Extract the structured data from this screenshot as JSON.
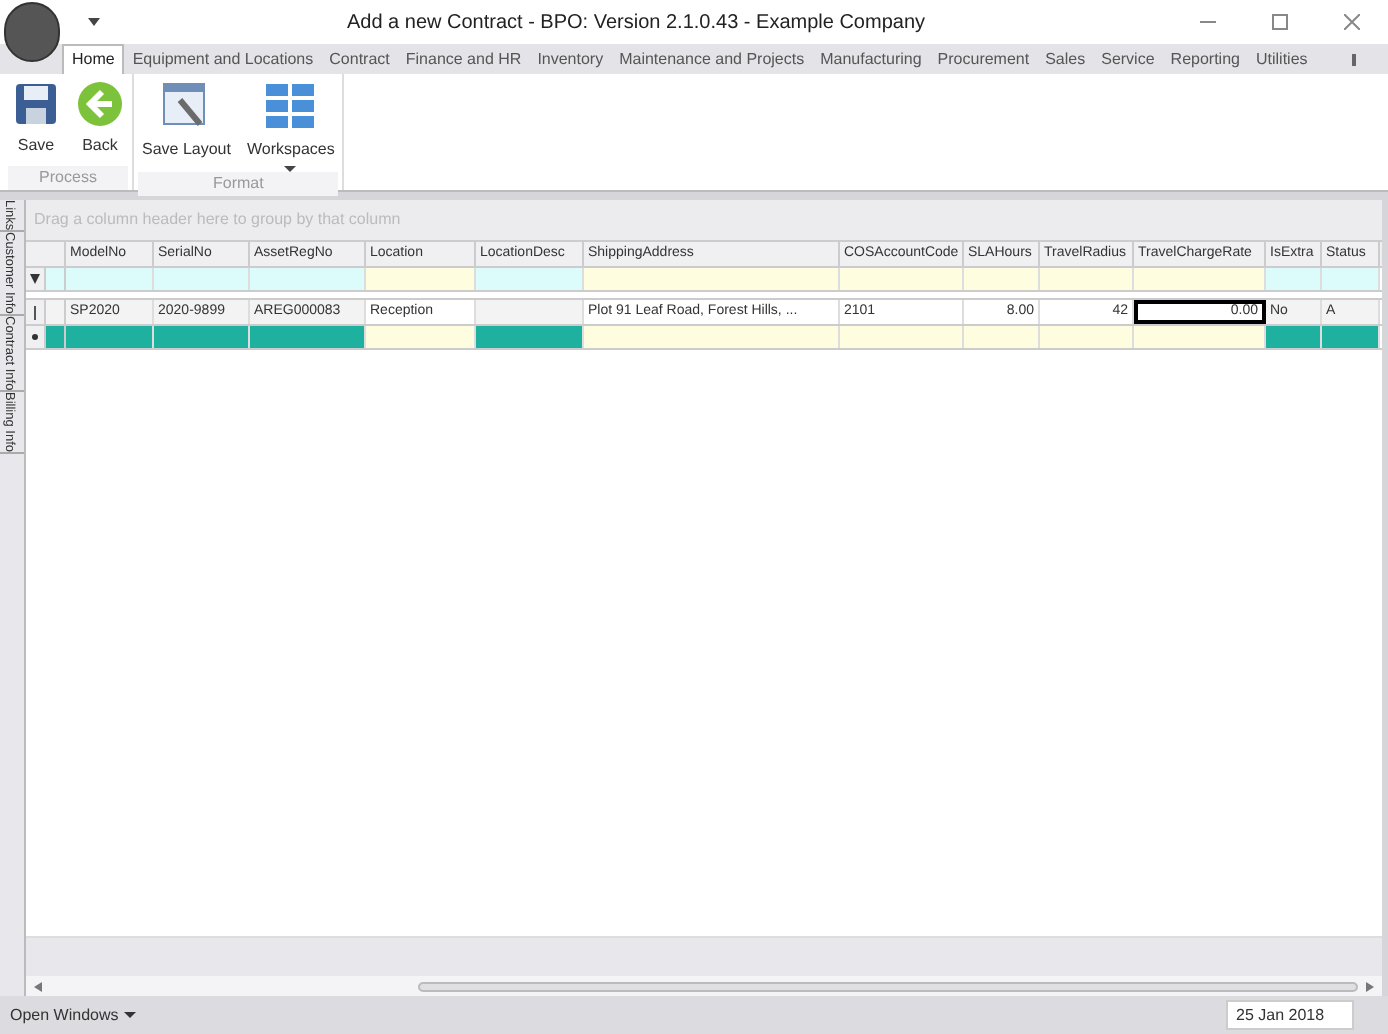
{
  "window": {
    "title": "Add a new Contract - BPO: Version 2.1.0.43 - Example Company"
  },
  "menu_tabs": [
    {
      "label": "Home",
      "selected": true
    },
    {
      "label": "Equipment and Locations",
      "selected": false
    },
    {
      "label": "Contract",
      "selected": false
    },
    {
      "label": "Finance and HR",
      "selected": false
    },
    {
      "label": "Inventory",
      "selected": false
    },
    {
      "label": "Maintenance and Projects",
      "selected": false
    },
    {
      "label": "Manufacturing",
      "selected": false
    },
    {
      "label": "Procurement",
      "selected": false
    },
    {
      "label": "Sales",
      "selected": false
    },
    {
      "label": "Service",
      "selected": false
    },
    {
      "label": "Reporting",
      "selected": false
    },
    {
      "label": "Utilities",
      "selected": false
    }
  ],
  "ribbon_groups": [
    {
      "label": "Process",
      "buttons": [
        {
          "kind": "save",
          "label": "Save"
        },
        {
          "kind": "back",
          "label": "Back"
        }
      ]
    },
    {
      "label": "Format",
      "buttons": [
        {
          "kind": "layout",
          "label": "Save Layout"
        },
        {
          "kind": "workspaces",
          "label": "Workspaces"
        }
      ]
    }
  ],
  "side_tabs": [
    "Links",
    "Customer Info",
    "Contract Info",
    "Billing Info"
  ],
  "group_panel": {
    "placeholder": "Drag a column header here to group by that column"
  },
  "columns": [
    {
      "label": "ModelNo",
      "kind": "readonly"
    },
    {
      "label": "SerialNo",
      "kind": "readonly"
    },
    {
      "label": "AssetRegNo",
      "kind": "readonly"
    },
    {
      "label": "Location",
      "kind": "editable"
    },
    {
      "label": "LocationDesc",
      "kind": "readonly"
    },
    {
      "label": "ShippingAddress",
      "kind": "editable"
    },
    {
      "label": "COSAccountCode",
      "kind": "editable"
    },
    {
      "label": "SLAHours",
      "kind": "editable"
    },
    {
      "label": "TravelRadius",
      "kind": "editable"
    },
    {
      "label": "TravelChargeRate",
      "kind": "editable"
    },
    {
      "label": "IsExtra",
      "kind": "readonly"
    },
    {
      "label": "Status",
      "kind": "readonly"
    }
  ],
  "rows": [
    {
      "cells": [
        {
          "text": "SP2020",
          "selected": false
        },
        {
          "text": "2020-9899",
          "selected": false
        },
        {
          "text": "AREG000083",
          "selected": false
        },
        {
          "text": "Reception",
          "selected": false
        },
        {
          "text": "",
          "selected": false
        },
        {
          "text": "Plot 91 Leaf Road, Forest Hills, ...",
          "selected": false
        },
        {
          "text": "2101",
          "selected": false
        },
        {
          "text": "8.00",
          "selected": false
        },
        {
          "text": "42",
          "selected": false
        },
        {
          "text": "0.00",
          "selected": true
        },
        {
          "text": "No",
          "selected": false
        },
        {
          "text": "A",
          "selected": false
        }
      ]
    }
  ],
  "status_bar": {
    "open_windows": "Open Windows",
    "date": "25 Jan 2018"
  }
}
